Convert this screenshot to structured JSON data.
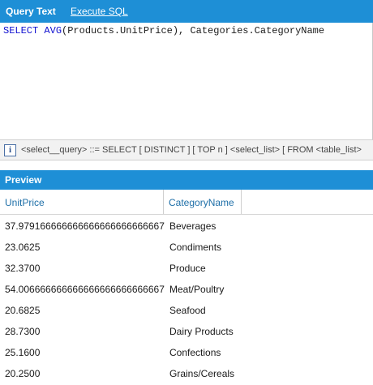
{
  "tabs": {
    "query_text": "Query Text",
    "execute_sql": "Execute SQL"
  },
  "editor": {
    "tokens": [
      {
        "text": "SELECT",
        "kind": "keyword"
      },
      {
        "text": " ",
        "kind": "plain"
      },
      {
        "text": "AVG",
        "kind": "keyword"
      },
      {
        "text": "(Products.UnitPrice), Categories.CategoryName",
        "kind": "plain"
      }
    ],
    "keyword_color": "#1010d0"
  },
  "hint": {
    "icon": "info-icon",
    "text": "<select__query> ::= SELECT [ DISTINCT ] [ TOP n ] <select_list> [ FROM <table_list>"
  },
  "preview": {
    "title": "Preview",
    "columns": [
      "UnitPrice",
      "CategoryName"
    ],
    "rows": [
      [
        "37.979166666666666666666666667",
        "Beverages"
      ],
      [
        "23.0625",
        "Condiments"
      ],
      [
        "32.3700",
        "Produce"
      ],
      [
        "54.006666666666666666666666667",
        "Meat/Poultry"
      ],
      [
        "20.6825",
        "Seafood"
      ],
      [
        "28.7300",
        "Dairy Products"
      ],
      [
        "25.1600",
        "Confections"
      ],
      [
        "20.2500",
        "Grains/Cereals"
      ]
    ]
  },
  "colors": {
    "accent": "#1e8fd6",
    "header_text": "#1e6fa8"
  }
}
